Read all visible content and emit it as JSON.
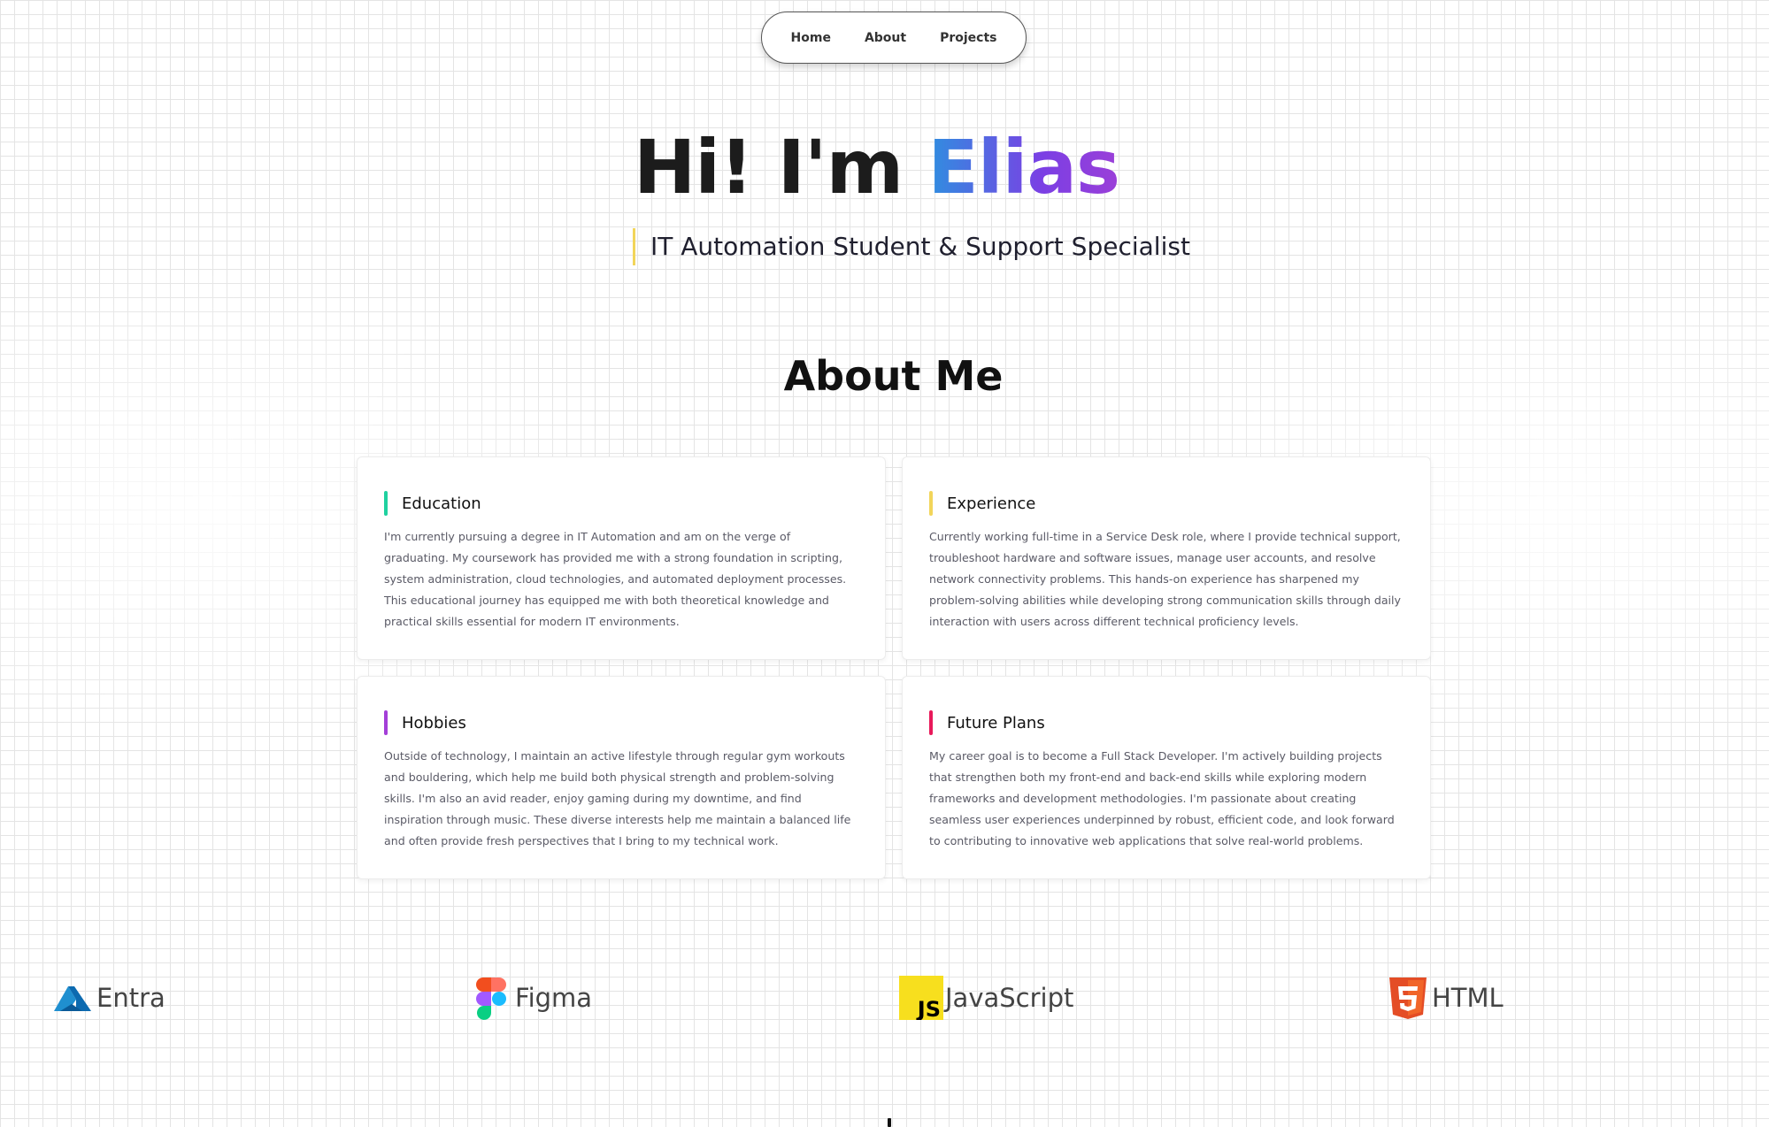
{
  "nav": {
    "items": [
      "Home",
      "About",
      "Projects"
    ]
  },
  "hero": {
    "greeting": "Hi! I'm ",
    "name": "Elias",
    "subtitle": "IT Automation Student & Support Specialist",
    "subtitle_accent": "#f2d55a"
  },
  "about": {
    "title": "About Me",
    "cards": [
      {
        "title": "Education",
        "accent": "#1fd1a0",
        "text": "I'm currently pursuing a degree in IT Automation and am on the verge of graduating. My coursework has provided me with a strong foundation in scripting, system administration, cloud technologies, and automated deployment processes. This educational journey has equipped me with both theoretical knowledge and practical skills essential for modern IT environments."
      },
      {
        "title": "Experience",
        "accent": "#f2d55a",
        "text": "Currently working full-time in a Service Desk role, where I provide technical support, troubleshoot hardware and software issues, manage user accounts, and resolve network connectivity problems. This hands-on experience has sharpened my problem-solving abilities while developing strong communication skills through daily interaction with users across different technical proficiency levels."
      },
      {
        "title": "Hobbies",
        "accent": "#a43fd8",
        "text": "Outside of technology, I maintain an active lifestyle through regular gym workouts and bouldering, which help me build both physical strength and problem-solving skills. I'm also an avid reader, enjoy gaming during my downtime, and find inspiration through music. These diverse interests help me maintain a balanced life and often provide fresh perspectives that I bring to my technical work."
      },
      {
        "title": "Future Plans",
        "accent": "#e8195a",
        "text": "My career goal is to become a Full Stack Developer. I'm actively building projects that strengthen both my front-end and back-end skills while exploring modern frameworks and development methodologies. I'm passionate about creating seamless user experiences underpinned by robust, efficient code, and look forward to contributing to innovative web applications that solve real-world problems."
      }
    ]
  },
  "tech": [
    {
      "label": "Entra",
      "icon": "entra-icon"
    },
    {
      "label": "Figma",
      "icon": "figma-icon"
    },
    {
      "label": "JavaScript",
      "icon": "javascript-icon"
    },
    {
      "label": "HTML",
      "icon": "html5-icon"
    }
  ]
}
